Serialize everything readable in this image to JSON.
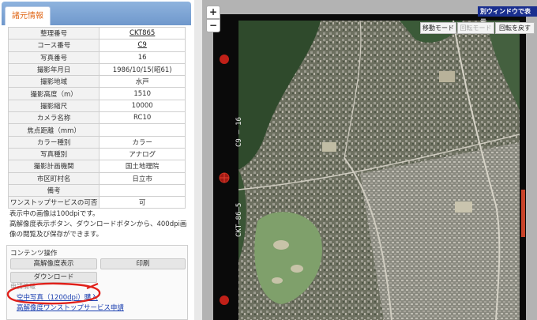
{
  "tab": {
    "label": "諸元情報"
  },
  "info_rows": [
    {
      "key": "整理番号",
      "value": "CKT865"
    },
    {
      "key": "コース番号",
      "value": "C9"
    },
    {
      "key": "写真番号",
      "value": "16"
    },
    {
      "key": "撮影年月日",
      "value": "1986/10/15(昭61)"
    },
    {
      "key": "撮影地域",
      "value": "水戸"
    },
    {
      "key": "撮影高度（m）",
      "value": "1510"
    },
    {
      "key": "撮影縮尺",
      "value": "10000"
    },
    {
      "key": "カメラ名称",
      "value": "RC10"
    },
    {
      "key": "焦点距離（mm）",
      "value": ""
    },
    {
      "key": "カラー種別",
      "value": "カラー"
    },
    {
      "key": "写真種別",
      "value": "アナログ"
    },
    {
      "key": "撮影計画機関",
      "value": "国土地理院"
    },
    {
      "key": "市区町村名",
      "value": "日立市"
    },
    {
      "key": "備考",
      "value": ""
    },
    {
      "key": "ワンストップサービスの可否",
      "value": "可"
    }
  ],
  "note": {
    "line1": "表示中の画像は100dpiです。",
    "line2": "高解像度表示ボタン、ダウンロードボタンから、400dpi画像の閲覧及び保存ができます。"
  },
  "contents": {
    "title": "コンテンツ操作",
    "hires_label": "高解像度表示",
    "print_label": "印刷",
    "download_label": "ダウンロード",
    "apply_label": "申請情報",
    "buy_link": "空中写真（1200dpi）購入",
    "onestop_link": "高解像度ワンストップサービス申請"
  },
  "map": {
    "new_window": "別ウィンドウで表示",
    "zoom_in": "+",
    "zoom_out": "−",
    "move_mode": "移動モード",
    "rotate_mode": "回転モード",
    "reset_rotation": "回転を戻す",
    "film_course": "C9 — 16",
    "film_id": "CKT—86—5"
  },
  "colors": {
    "tab_active_text": "#e06a1b",
    "link": "#1a3fb0",
    "annotation_circle": "#e0201a",
    "new_window_bg": "#1a2f8f"
  }
}
